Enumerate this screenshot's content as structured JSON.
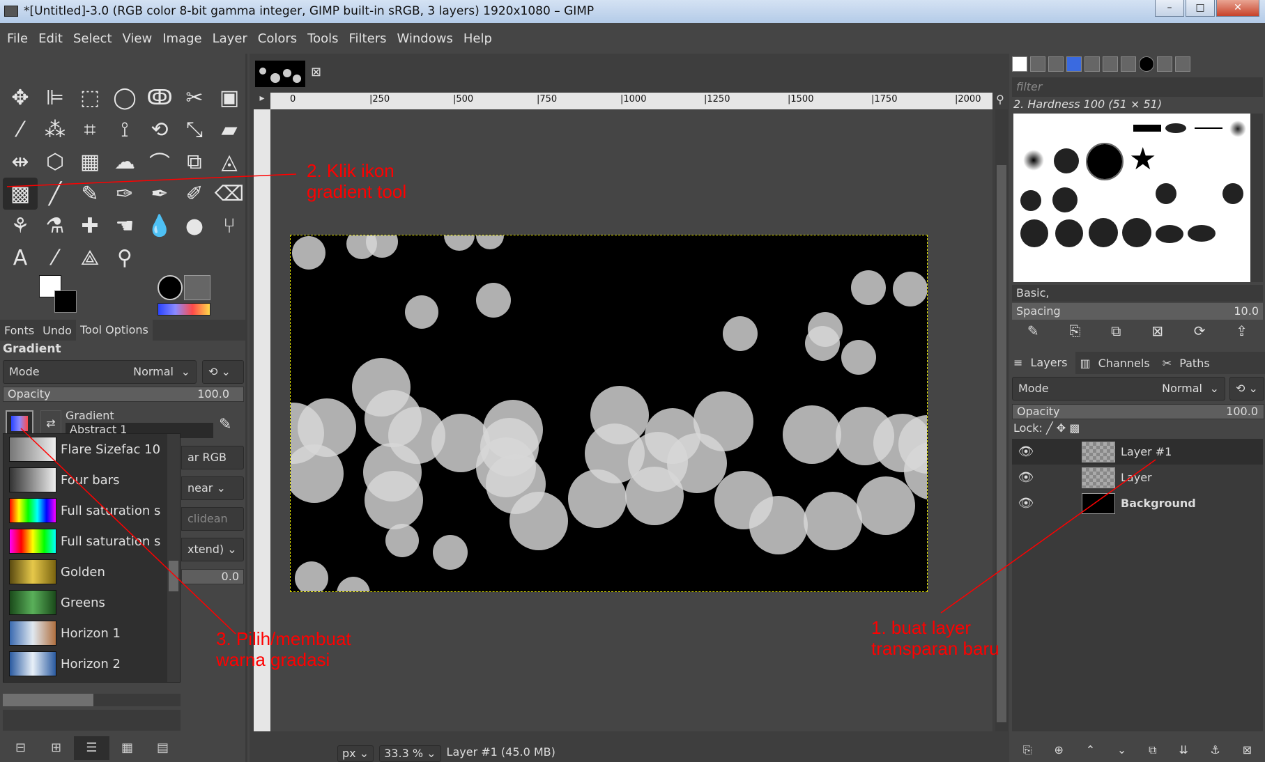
{
  "window": {
    "title": "*[Untitled]-3.0 (RGB color 8-bit gamma integer, GIMP built-in sRGB, 3 layers) 1920x1080 – GIMP",
    "min": "–",
    "max": "□",
    "close": "✕"
  },
  "menu": [
    "File",
    "Edit",
    "Select",
    "View",
    "Image",
    "Layer",
    "Colors",
    "Tools",
    "Filters",
    "Windows",
    "Help"
  ],
  "dock_tabs": {
    "fonts": "Fonts",
    "undo": "Undo",
    "tool_options": "Tool Options"
  },
  "tool_options": {
    "title": "Gradient",
    "mode_label": "Mode",
    "mode_value": "Normal",
    "opacity_label": "Opacity",
    "opacity_value": "100.0",
    "gradient_label": "Gradient",
    "gradient_value": "Abstract 1",
    "blend_color_space": "ar RGB",
    "shape": "near",
    "metric": "clidean",
    "repeat": "xtend)",
    "offset": "0.0"
  },
  "gradients": [
    {
      "name": "Flare Sizefac 10",
      "colors": [
        "#777",
        "#eee"
      ]
    },
    {
      "name": "Four bars",
      "colors": [
        "#333",
        "#eee"
      ]
    },
    {
      "name": "Full saturation s",
      "colors": [
        "#f00",
        "#ff0",
        "#0f0",
        "#0ff",
        "#00f",
        "#f0f"
      ]
    },
    {
      "name": "Full saturation s",
      "colors": [
        "#f0f",
        "#f00",
        "#ff0",
        "#0f0",
        "#0ff"
      ]
    },
    {
      "name": "Golden",
      "colors": [
        "#5a4a10",
        "#e6c84a",
        "#7a6410"
      ]
    },
    {
      "name": "Greens",
      "colors": [
        "#1a4a1a",
        "#5ab05a",
        "#1a4a1a"
      ]
    },
    {
      "name": "Horizon 1",
      "colors": [
        "#3a6ab0",
        "#e0e8f0",
        "#b07040"
      ]
    },
    {
      "name": "Horizon 2",
      "colors": [
        "#2a5aa0",
        "#e8f0f8",
        "#2a5aa0"
      ]
    }
  ],
  "canvas": {
    "ruler_marks": [
      "0",
      "|250",
      "|500",
      "|750",
      "|1000",
      "|1250",
      "|1500",
      "|1750",
      "|2000"
    ]
  },
  "status": {
    "unit": "px",
    "zoom": "33.3 %",
    "layer_info": "Layer #1 (45.0 MB)"
  },
  "brushes": {
    "filter_placeholder": "filter",
    "selected_name": "2. Hardness 100 (51 × 51)",
    "tag": "Basic,",
    "spacing_label": "Spacing",
    "spacing_value": "10.0"
  },
  "layers_tabs": {
    "layers": "Layers",
    "channels": "Channels",
    "paths": "Paths"
  },
  "layers_panel": {
    "mode_label": "Mode",
    "mode_value": "Normal",
    "opacity_label": "Opacity",
    "opacity_value": "100.0",
    "lock_label": "Lock:"
  },
  "layers": [
    {
      "name": "Layer #1",
      "thumb": "checker"
    },
    {
      "name": "Layer",
      "thumb": "checker"
    },
    {
      "name": "Background",
      "thumb": "black"
    }
  ],
  "annotations": {
    "a1": "1. buat layer\ntransparan baru",
    "a2": "2. Klik ikon\ngradient tool",
    "a3": "3. Pilih/membuat\nwarna gradasi"
  },
  "colors": {
    "annotation": "#ff0000",
    "selection_border": "#e0e000",
    "fg": "#ffffff",
    "bg": "#000000"
  }
}
